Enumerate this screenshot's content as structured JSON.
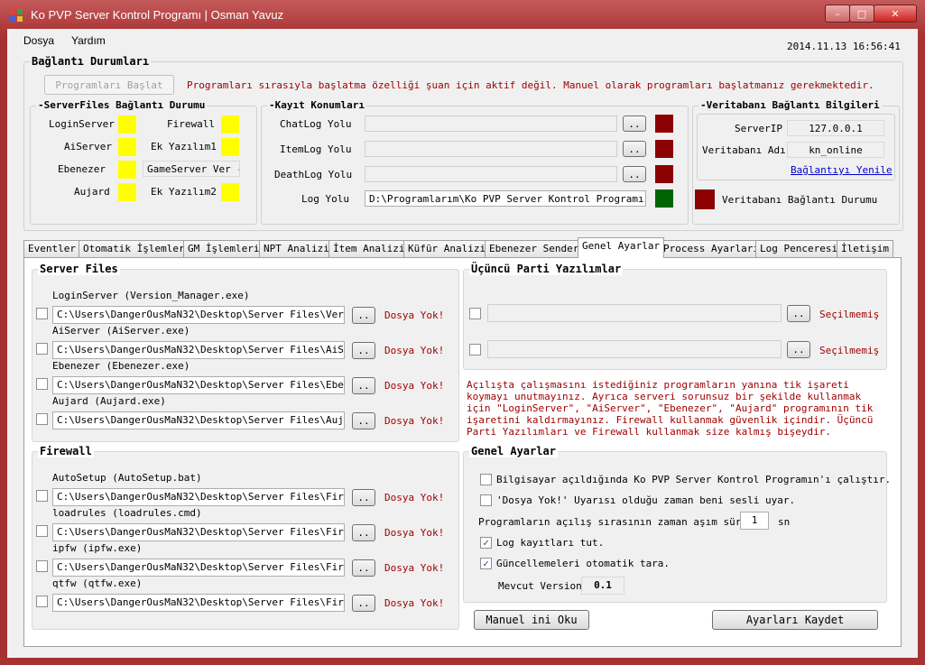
{
  "window": {
    "title": "Ko PVP Server Kontrol Programı | Osman Yavuz",
    "min": "–",
    "max": "□",
    "close": "✕"
  },
  "menu": {
    "file": "Dosya",
    "help": "Yardım"
  },
  "clock": "2014.11.13 16:56:41",
  "connection": {
    "title": "Bağlantı Durumları",
    "start_button": "Programları Başlat",
    "notice": "Programları sırasıyla başlatma özelliği şuan için aktif değil. Manuel olarak programları başlatmanız gerekmektedir."
  },
  "serverfiles_status": {
    "title": "-ServerFiles Bağlantı Durumu",
    "login": "LoginServer",
    "firewall": "Firewall",
    "ai": "AiServer",
    "ek1": "Ek Yazılım1",
    "ebenezer": "Ebenezer",
    "gameserver": "GameServer Ver -",
    "aujard": "Aujard",
    "ek2": "Ek Yazılım2",
    "indicator_color": "#ffff00"
  },
  "log_locations": {
    "title": "-Kayıt Konumları",
    "chat": "ChatLog Yolu",
    "item": "ItemLog Yolu",
    "death": "DeathLog Yolu",
    "log": "Log Yolu",
    "log_path": "D:\\Programlarım\\Ko PVP Server Kontrol Programı Source",
    "browse": "..",
    "red_color": "#8b0000",
    "green_color": "#006400"
  },
  "db": {
    "title": "-Veritabanı Bağlantı Bilgileri",
    "ip_label": "ServerIP",
    "ip_value": "127.0.0.1",
    "name_label": "Veritabanı Adı",
    "name_value": "kn_online",
    "refresh": "Bağlantıyı Yenile",
    "status": "Veritabanı Bağlantı Durumu"
  },
  "tabs": [
    "Eventler",
    "Otomatik İşlemler",
    "GM İşlemleri",
    "NPT Analizi",
    "İtem Analizi",
    "Küfür Analizi",
    "Ebenezer Sender",
    "Genel Ayarlar",
    "Process Ayarları",
    "Log Penceresi",
    "İletişim"
  ],
  "server_files": {
    "title": "Server Files",
    "items": [
      {
        "label": "LoginServer (Version_Manager.exe)",
        "path": "C:\\Users\\DangerOusMaN32\\Desktop\\Server Files\\Version_Manager.exe",
        "status": "Dosya Yok!"
      },
      {
        "label": "AiServer (AiServer.exe)",
        "path": "C:\\Users\\DangerOusMaN32\\Desktop\\Server Files\\AiServer.exe",
        "status": "Dosya Yok!"
      },
      {
        "label": "Ebenezer (Ebenezer.exe)",
        "path": "C:\\Users\\DangerOusMaN32\\Desktop\\Server Files\\Ebenezer.exe",
        "status": "Dosya Yok!"
      },
      {
        "label": "Aujard (Aujard.exe)",
        "path": "C:\\Users\\DangerOusMaN32\\Desktop\\Server Files\\Aujard.exe",
        "status": "Dosya Yok!"
      }
    ]
  },
  "firewall": {
    "title": "Firewall",
    "items": [
      {
        "label": "AutoSetup (AutoSetup.bat)",
        "path": "C:\\Users\\DangerOusMaN32\\Desktop\\Server Files\\Firewall\\AutoSetup.bat",
        "status": "Dosya Yok!"
      },
      {
        "label": "loadrules (loadrules.cmd)",
        "path": "C:\\Users\\DangerOusMaN32\\Desktop\\Server Files\\Firewall\\loadrules.cmd",
        "status": "Dosya Yok!"
      },
      {
        "label": "ipfw (ipfw.exe)",
        "path": "C:\\Users\\DangerOusMaN32\\Desktop\\Server Files\\Firewall\\ipfw.exe",
        "status": "Dosya Yok!"
      },
      {
        "label": "qtfw (qtfw.exe)",
        "path": "C:\\Users\\DangerOusMaN32\\Desktop\\Server Files\\Firewall\\qtfw.exe",
        "status": "Dosya Yok!"
      }
    ]
  },
  "third_party": {
    "title": "Üçüncü Parti Yazılımlar",
    "status": "Seçilmemiş",
    "info": "Açılışta çalışmasını istediğiniz programların yanına tik işareti koymayı unutmayınız. Ayrıca serveri sorunsuz bir şekilde kullanmak için \"LoginServer\", \"AiServer\", \"Ebenezer\", \"Aujard\" programının tik işaretini kaldırmayınız.  Firewall kullanmak güvenlik içindir. Üçüncü Parti Yazılımları ve Firewall kullanmak size kalmış bişeydir."
  },
  "general": {
    "title": "Genel Ayarlar",
    "autostart": "Bilgisayar açıldığında Ko PVP Server Kontrol Programın'ı çalıştır.",
    "sound": "'Dosya Yok!' Uyarısı olduğu zaman beni sesli uyar.",
    "timeout_label": "Programların açılış sırasının zaman aşım süresi",
    "timeout_value": "1",
    "timeout_unit": "sn",
    "log": "Log kayıtları tut.",
    "updates": "Güncellemeleri otomatik tara.",
    "version_label": "Mevcut Version:",
    "version_value": "0.1",
    "check_mark": "✓"
  },
  "buttons": {
    "read_ini": "Manuel ini Oku",
    "save": "Ayarları Kaydet"
  }
}
